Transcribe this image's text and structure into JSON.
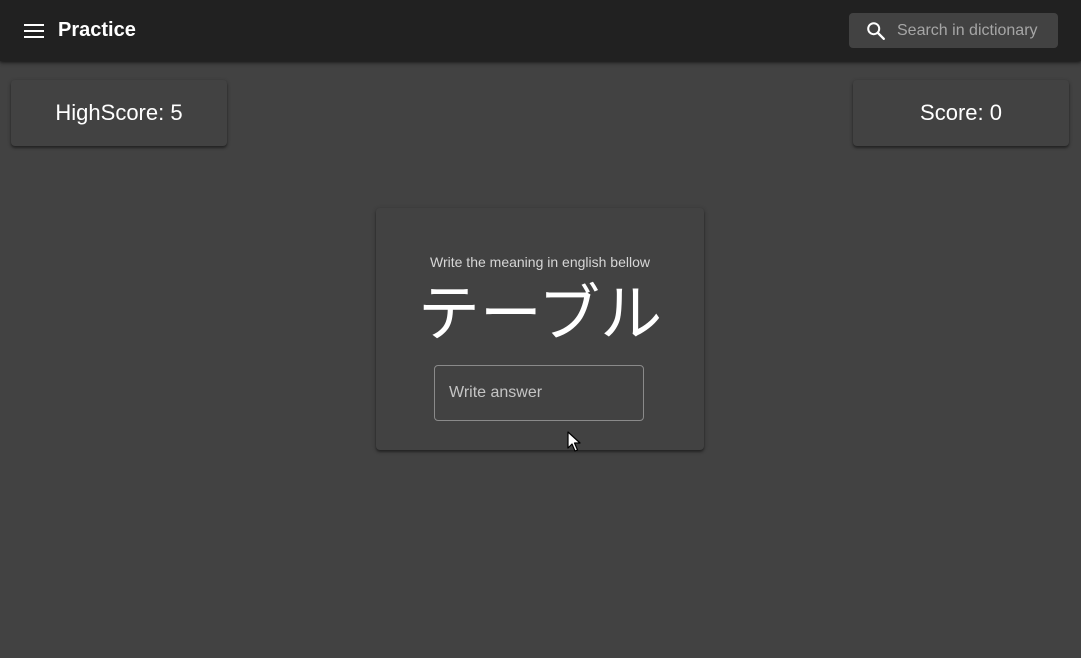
{
  "header": {
    "title": "Practice",
    "menu_icon": "menu-icon",
    "search": {
      "icon": "search-icon",
      "placeholder": "Search in dictionary",
      "value": ""
    }
  },
  "scores": {
    "highscore_label": "HighScore: 5",
    "score_label": "Score: 0"
  },
  "practice": {
    "instruction": "Write the meaning in english bellow",
    "word": "テーブル",
    "answer": {
      "placeholder": "Write answer",
      "value": ""
    }
  },
  "colors": {
    "appbar": "#212121",
    "background": "#424242",
    "text": "#ffffff"
  }
}
